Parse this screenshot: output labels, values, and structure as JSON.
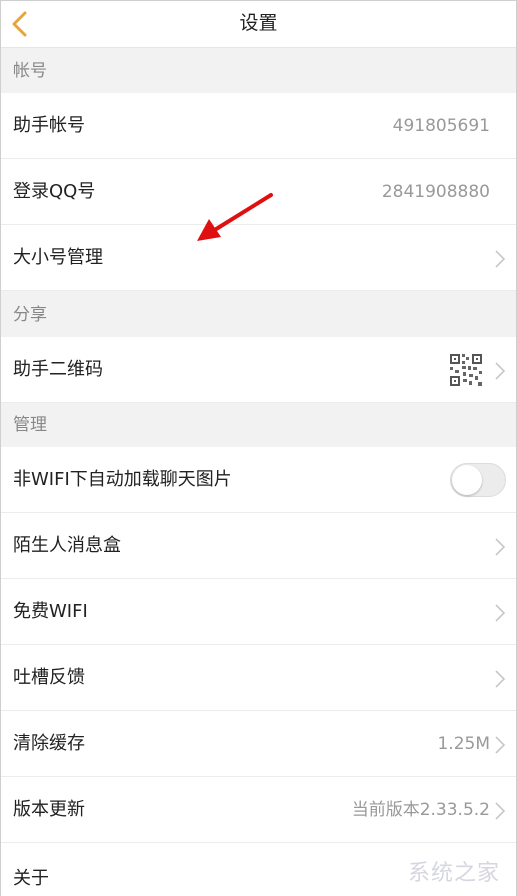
{
  "header": {
    "title": "设置",
    "back_icon": "chevron-left-icon",
    "accent": "#e8a33b"
  },
  "sections": {
    "account": "帐号",
    "share": "分享",
    "manage": "管理"
  },
  "rows": {
    "assistant_account": {
      "label": "助手帐号",
      "value": "491805691"
    },
    "login_qq": {
      "label": "登录QQ号",
      "value": "2841908880"
    },
    "account_management": {
      "label": "大小号管理"
    },
    "assistant_qrcode": {
      "label": "助手二维码",
      "icon": "qr-code-icon"
    },
    "auto_load_images": {
      "label": "非WIFI下自动加载聊天图片",
      "toggle_on": false
    },
    "stranger_box": {
      "label": "陌生人消息盒"
    },
    "free_wifi": {
      "label": "免费WIFI"
    },
    "feedback": {
      "label": "吐槽反馈"
    },
    "clear_cache": {
      "label": "清除缓存",
      "value": "1.25M"
    },
    "version_update": {
      "label": "版本更新",
      "value": "当前版本2.33.5.2"
    },
    "about": {
      "label": "关于"
    }
  },
  "annotation": {
    "arrow_color": "#e01010"
  },
  "watermark": {
    "text": "系统之家"
  }
}
